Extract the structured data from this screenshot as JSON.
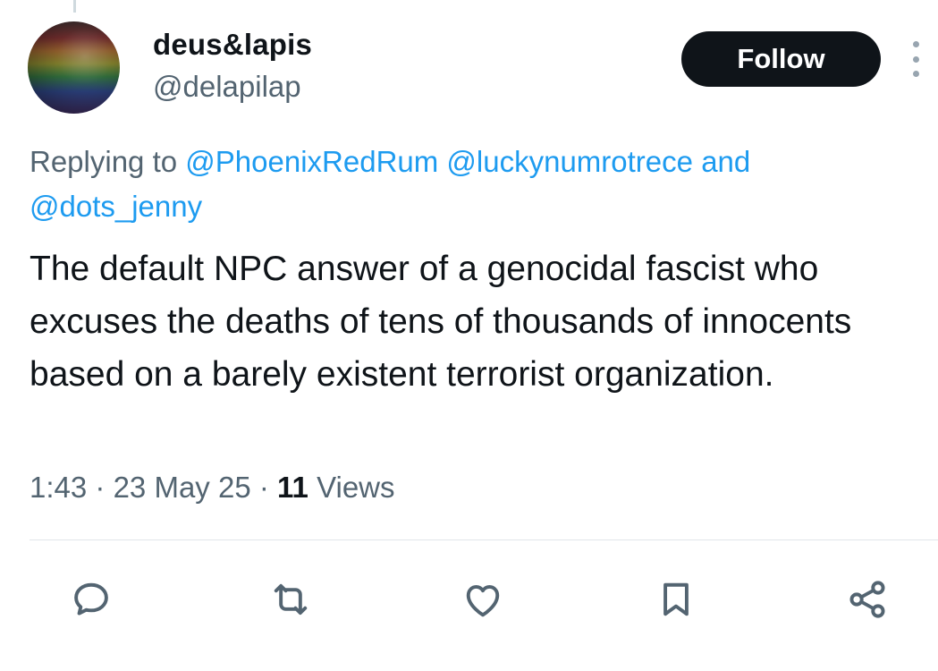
{
  "author": {
    "display_name": "deus&lapis",
    "handle": "@delapilap"
  },
  "follow_label": "Follow",
  "reply": {
    "prefix": "Replying to",
    "mentions": [
      "@PhoenixRedRum",
      "@luckynumrotrece"
    ],
    "and_text": "and",
    "last_mention": "@dots_jenny"
  },
  "tweet": {
    "text": "The default NPC answer of a genocidal fascist who excuses the deaths of tens of thousands of innocents based on a barely existent terrorist organization."
  },
  "meta": {
    "time": "1:43",
    "separator": "·",
    "date": "23 May 25",
    "views_count": "11",
    "views_label": "Views"
  },
  "actions": {
    "icons": [
      "comment-icon",
      "retweet-icon",
      "like-icon",
      "bookmark-icon",
      "share-icon"
    ]
  },
  "colors": {
    "text": "#0f1419",
    "secondary": "#536471",
    "link": "#1d9bf0",
    "icon": "#536471",
    "button_bg": "#0f1419"
  }
}
